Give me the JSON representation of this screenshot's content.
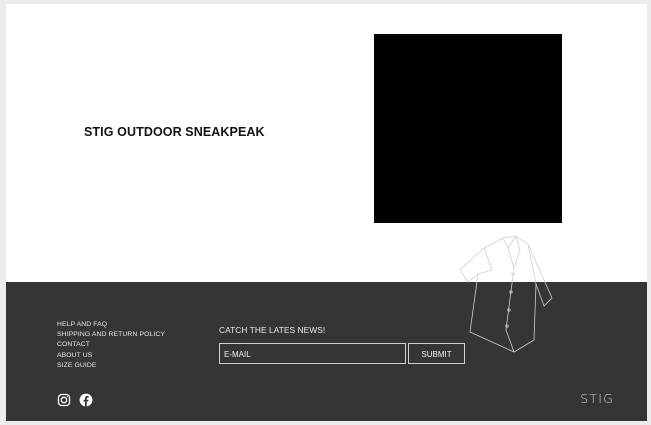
{
  "hero": {
    "title": "STIG OUTDOOR SNEAKPEAK"
  },
  "footer": {
    "links": [
      {
        "label": "HELP AND FAQ"
      },
      {
        "label": "SHIPPING AND  RETURN POLICY"
      },
      {
        "label": "CONTACT"
      },
      {
        "label": "ABOUT US"
      },
      {
        "label": "SIZE GUIDE"
      }
    ],
    "newsletter": {
      "title": "CATCH THE LATES NEWS!",
      "email_placeholder": "E-MAIL",
      "submit_label": "SUBMIT"
    },
    "social": [
      {
        "icon": "instagram-icon"
      },
      {
        "icon": "facebook-icon"
      }
    ],
    "brand": "STIG"
  },
  "colors": {
    "footer_bg": "#353535",
    "page_bg": "#ffffff",
    "image_placeholder": "#000000"
  }
}
